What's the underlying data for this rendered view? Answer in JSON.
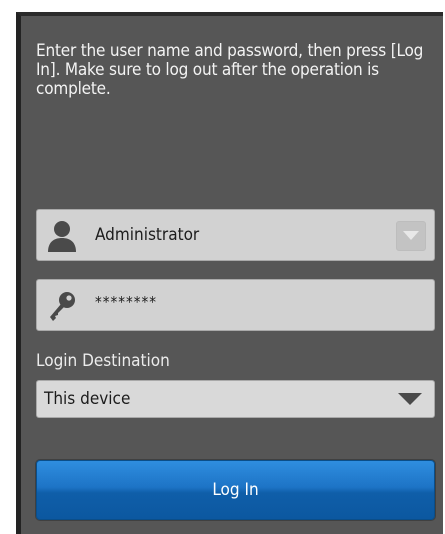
{
  "instructions": "Enter the user name and password, then press [Log In]. Make sure to log out after the operation is complete.",
  "username": {
    "value": "Administrator",
    "icon": "user-icon",
    "dropdown_icon": "chevron-down-icon"
  },
  "password": {
    "value": "********",
    "icon": "key-icon"
  },
  "login_destination": {
    "label": "Login Destination",
    "selected": "This device",
    "icon": "chevron-down-icon"
  },
  "login_button": {
    "label": "Log In",
    "color": "#1d74c6"
  },
  "colors": {
    "panel": "#565656",
    "field": "#d2d2d2"
  }
}
